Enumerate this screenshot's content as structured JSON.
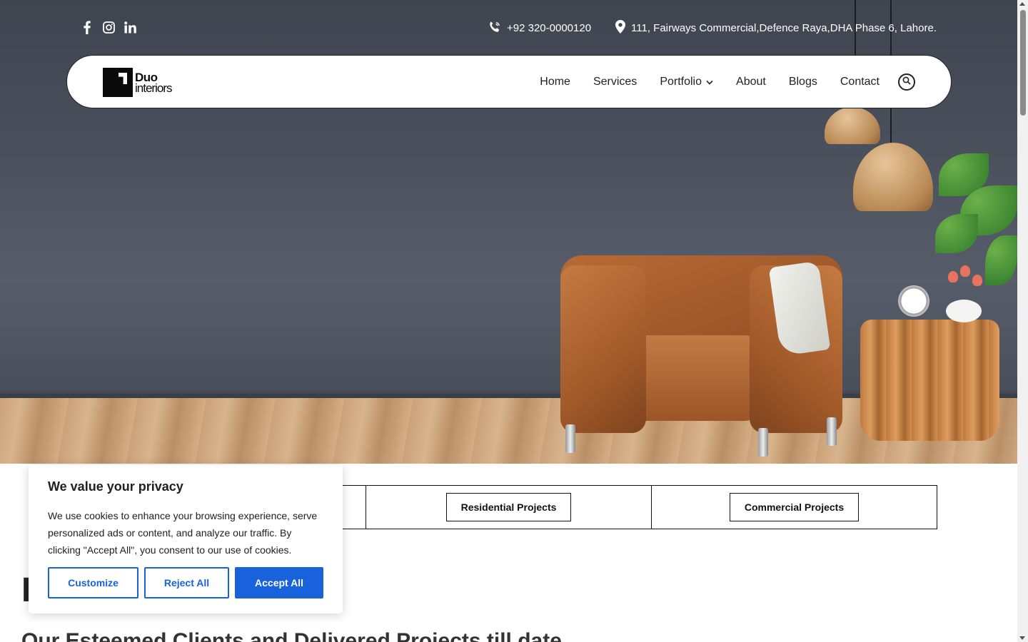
{
  "topbar": {
    "social": [
      "facebook-icon",
      "instagram-icon",
      "linkedin-icon"
    ],
    "phone": "+92 320-0000120",
    "address": "111, Fairways Commercial,Defence Raya,DHA Phase 6, Lahore."
  },
  "logo": {
    "line1": "Duo",
    "line2": "interiors"
  },
  "nav": {
    "items": [
      "Home",
      "Services",
      "Portfolio",
      "About",
      "Blogs",
      "Contact"
    ]
  },
  "tabs": [
    "Residential Projects",
    "Commercial Projects"
  ],
  "sections": {
    "heading_partial": "H",
    "subheading": "Our Esteemed Clients and Delivered Projects till date"
  },
  "cookie": {
    "title": "We value your privacy",
    "body": "We use cookies to enhance your browsing experience, serve personalized ads or content, and analyze our traffic. By clicking \"Accept All\", you consent to our use of cookies.",
    "customize": "Customize",
    "reject": "Reject All",
    "accept": "Accept All"
  },
  "colors": {
    "accent": "#1863dc",
    "hero_wall": "#4b515d",
    "text": "#212121"
  }
}
